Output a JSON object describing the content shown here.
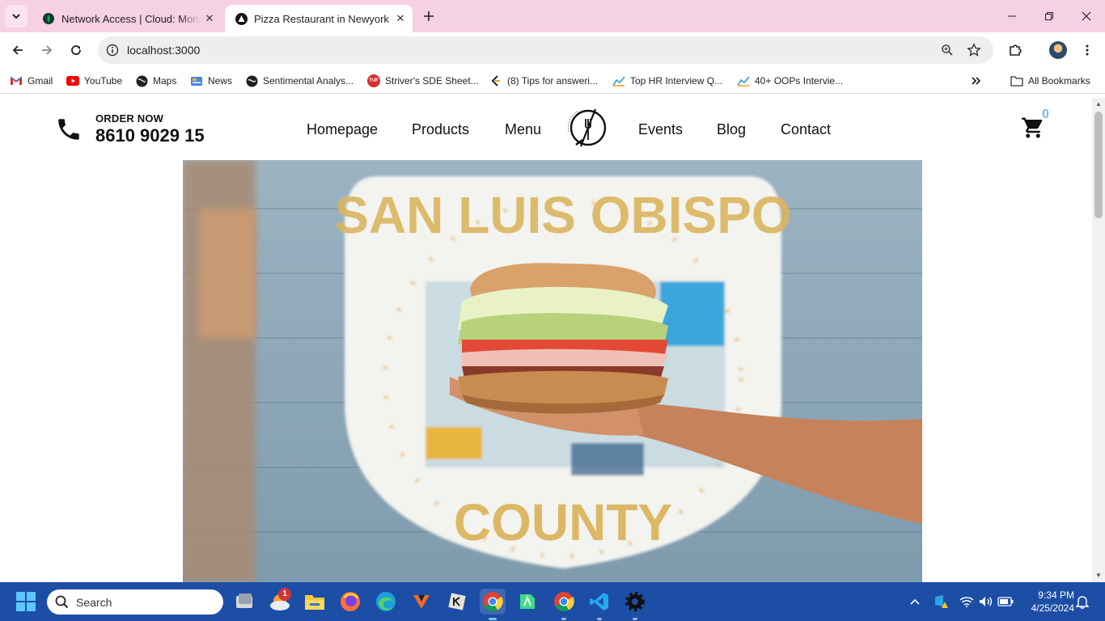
{
  "browser": {
    "tabs": [
      {
        "title": "Network Access | Cloud: MongoDB Cloud",
        "active": false
      },
      {
        "title": "Pizza Restaurant in Newyork",
        "active": true
      }
    ],
    "url": "localhost:3000",
    "bookmarks": [
      {
        "label": "Gmail",
        "icon": "gmail-icon"
      },
      {
        "label": "YouTube",
        "icon": "youtube-icon"
      },
      {
        "label": "Maps",
        "icon": "maps-icon"
      },
      {
        "label": "News",
        "icon": "news-icon"
      },
      {
        "label": "Sentimental Analys...",
        "icon": "globe-icon"
      },
      {
        "label": "Striver's SDE Sheet...",
        "icon": "tuf-icon"
      },
      {
        "label": "(8) Tips for answeri...",
        "icon": "leetcode-icon"
      },
      {
        "label": "Top HR Interview Q...",
        "icon": "chart-icon"
      },
      {
        "label": "40+ OOPs Intervie...",
        "icon": "chart-icon"
      }
    ],
    "all_bookmarks": "All Bookmarks"
  },
  "site": {
    "order_label": "ORDER NOW",
    "order_phone": "8610 9029 15",
    "nav": {
      "homepage": "Homepage",
      "products": "Products",
      "menu": "Menu",
      "events": "Events",
      "blog": "Blog",
      "contact": "Contact"
    },
    "cart_count": "0",
    "hero": {
      "sign_top": "SAN LUIS OBISPO",
      "sign_bottom": "COUNTY"
    }
  },
  "taskbar": {
    "search_placeholder": "Search",
    "notification_badge": "1",
    "time": "9:34 PM",
    "date": "4/25/2024"
  },
  "colors": {
    "tabstrip": "#f6d0e3",
    "taskbar": "#1c4ea6",
    "cart_count": "#7fb9e6"
  }
}
